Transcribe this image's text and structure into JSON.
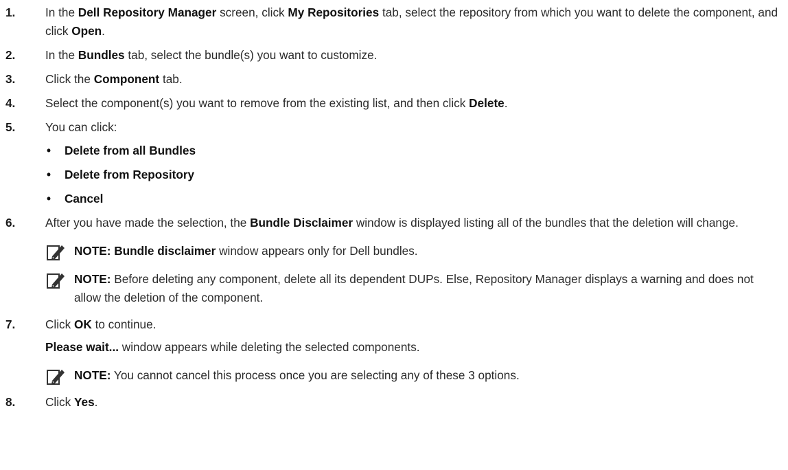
{
  "steps": [
    {
      "num": "1.",
      "t1": "In the ",
      "b1": "Dell Repository Manager",
      "t2": " screen, click ",
      "b2": "My Repositories",
      "t3": " tab, select the repository from which you want to delete the component, and click ",
      "b3": "Open",
      "t4": "."
    },
    {
      "num": "2.",
      "t1": "In the ",
      "b1": "Bundles",
      "t2": " tab, select the bundle(s) you want to customize."
    },
    {
      "num": "3.",
      "t1": "Click the ",
      "b1": "Component",
      "t2": " tab."
    },
    {
      "num": "4.",
      "t1": "Select the component(s) you want to remove from the existing list, and then click ",
      "b1": "Delete",
      "t2": "."
    },
    {
      "num": "5.",
      "t1": "You can click:",
      "bullets": [
        "Delete from all Bundles",
        "Delete from Repository",
        "Cancel"
      ]
    },
    {
      "num": "6.",
      "t1": "After you have made the selection, the ",
      "b1": "Bundle Disclaimer",
      "t2": " window is displayed listing all of the bundles that the deletion will change."
    },
    {
      "num": "7.",
      "t1": "Click ",
      "b1": "OK",
      "t2": " to continue.",
      "p_b": "Please wait...",
      "p_t": " window appears while deleting the selected components."
    },
    {
      "num": "8.",
      "t1": "Click ",
      "b1": "Yes",
      "t2": "."
    }
  ],
  "bullet_char": "•",
  "notes": [
    {
      "label": "NOTE:",
      "b": "Bundle disclaimer",
      "t": " window appears only for Dell bundles."
    },
    {
      "label": "NOTE:",
      "t": " Before deleting any component, delete all its dependent DUPs. Else, Repository Manager displays a warning and does not allow the deletion of the component."
    },
    {
      "label": "NOTE:",
      "t": " You cannot cancel this process once you are selecting any of these 3 options."
    }
  ],
  "icons": {
    "note": "note-pencil-icon"
  }
}
